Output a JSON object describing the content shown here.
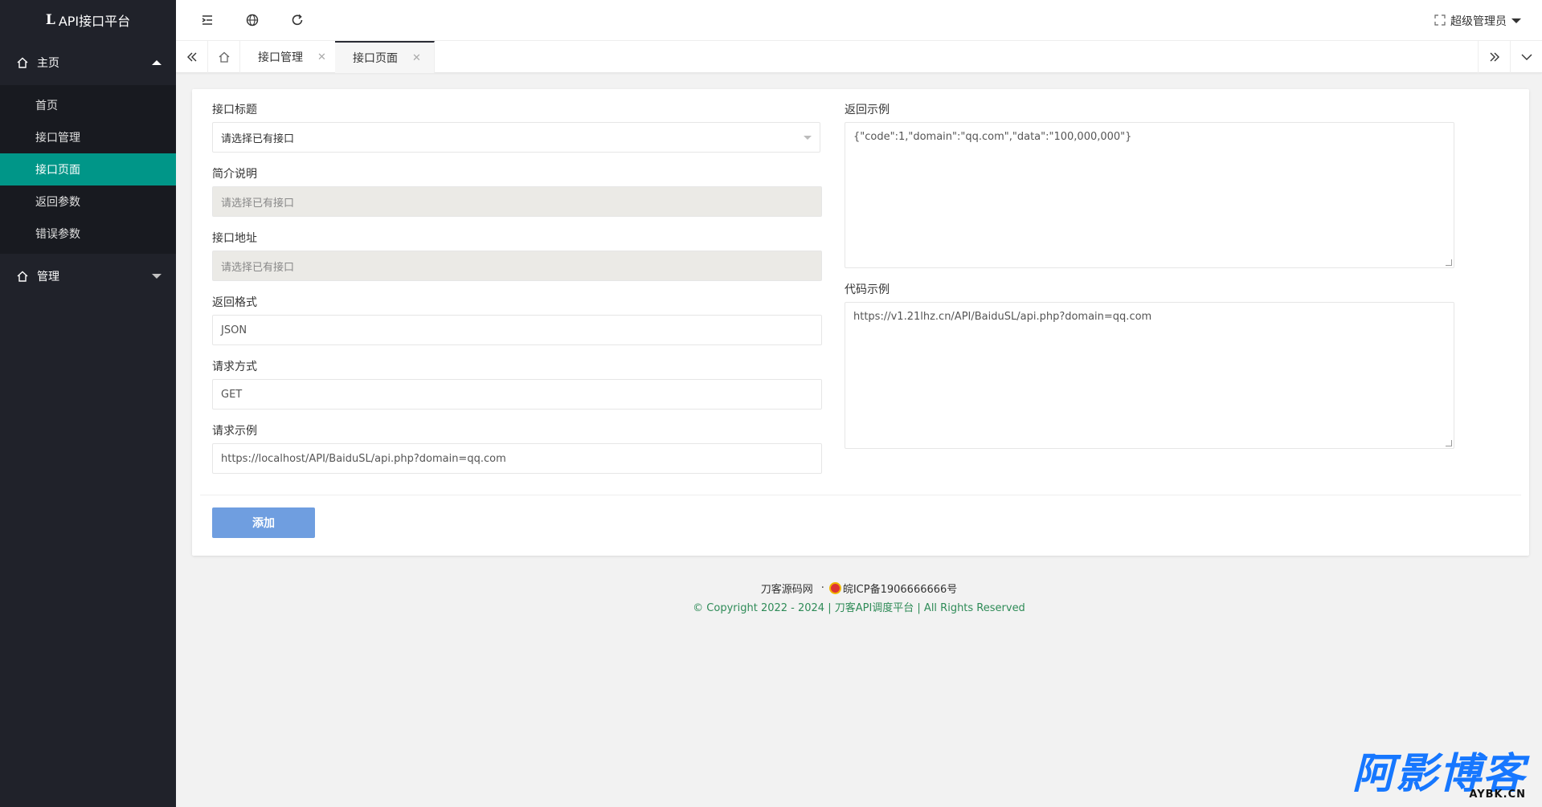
{
  "app": {
    "logo_mark": "𝐋",
    "title": "API接口平台"
  },
  "sidebar": {
    "group_main": "主页",
    "items": [
      "首页",
      "接口管理",
      "接口页面",
      "返回参数",
      "错误参数"
    ],
    "group_manage": "管理"
  },
  "header": {
    "admin": "超级管理员"
  },
  "tabs": [
    {
      "label": "接口管理"
    },
    {
      "label": "接口页面"
    }
  ],
  "form": {
    "title_label": "接口标题",
    "title_value": "请选择已有接口",
    "desc_label": "简介说明",
    "desc_value": "请选择已有接口",
    "addr_label": "接口地址",
    "addr_value": "请选择已有接口",
    "format_label": "返回格式",
    "format_value": "JSON",
    "method_label": "请求方式",
    "method_value": "GET",
    "example_label": "请求示例",
    "example_value": "https://localhost/API/BaiduSL/api.php?domain=qq.com",
    "return_label": "返回示例",
    "return_value": "{\"code\":1,\"domain\":\"qq.com\",\"data\":\"100,000,000\"}",
    "code_label": "代码示例",
    "code_value": "https://v1.21lhz.cn/API/BaiduSL/api.php?domain=qq.com",
    "submit": "添加"
  },
  "footer": {
    "site": "刀客源码网",
    "sep": "·",
    "icp": "皖ICP备1906666666号",
    "copyright": "© Copyright 2022 - 2024 | 刀客API调度平台 | All Rights Reserved"
  },
  "watermark": {
    "cn": "阿影博客",
    "en": "AYBK.CN"
  },
  "colors": {
    "sidebar": "#20222a",
    "active": "#009688",
    "button": "#6f9ee0",
    "footer_link": "#2e8b57"
  }
}
